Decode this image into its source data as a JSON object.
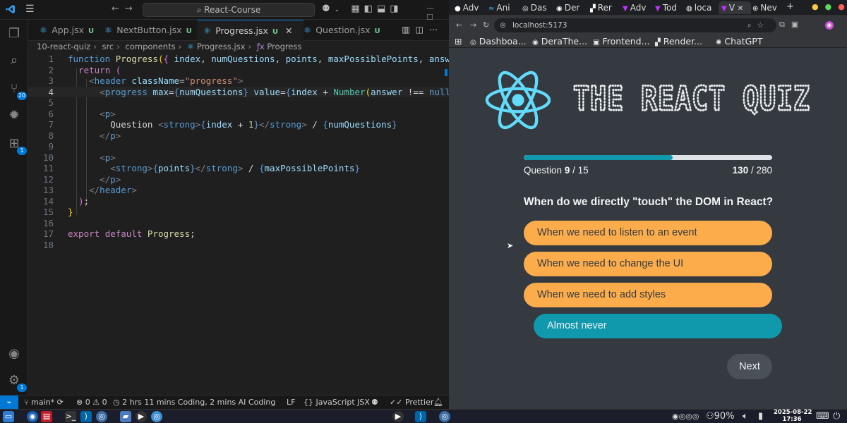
{
  "vscode": {
    "search_text": "React-Course",
    "tabs": [
      {
        "name": "App.jsx",
        "status": "U"
      },
      {
        "name": "NextButton.jsx",
        "status": "U"
      },
      {
        "name": "Progress.jsx",
        "status": "U",
        "active": true
      },
      {
        "name": "Question.jsx",
        "status": "U"
      }
    ],
    "breadcrumb": [
      "10-react-quiz",
      "src",
      "components",
      "Progress.jsx",
      "Progress"
    ],
    "activity_badges": {
      "source_control": "20",
      "extensions": "1",
      "settings": "1"
    },
    "line_numbers": [
      "1",
      "2",
      "3",
      "4",
      "5",
      "6",
      "7",
      "8",
      "9",
      "10",
      "11",
      "12",
      "13",
      "14",
      "15",
      "16",
      "17",
      "18"
    ],
    "current_line": 4,
    "status": {
      "branch": "main*",
      "errors": "0",
      "warnings": "0",
      "ports": "0",
      "coding_time": "2 hrs 11 mins Coding, 2 mins AI Coding",
      "eol": "LF",
      "language": "JavaScript JSX",
      "formatter": "Prettier"
    }
  },
  "browser": {
    "tabs": [
      "Adv",
      "Ani",
      "Das",
      "Der",
      "Rer",
      "Adv",
      "Tod",
      "loca",
      "V",
      "Nev"
    ],
    "url": "localhost:5173",
    "bookmarks": [
      "Dashboa...",
      "DeraThe...",
      "Frontend...",
      "Render...",
      "ChatGPT"
    ]
  },
  "quiz": {
    "title": "THE REACT QUIZ",
    "progress": {
      "index": 9,
      "numQuestions": 15,
      "points": 130,
      "maxPossiblePoints": 280,
      "question_label": "Question",
      "fill_fraction": 0.6
    },
    "question": "When do we directly \"touch\" the DOM in React?",
    "options": [
      {
        "text": "When we need to listen to an event",
        "selected": false
      },
      {
        "text": "When we need to change the UI",
        "selected": false
      },
      {
        "text": "When we need to add styles",
        "selected": false
      },
      {
        "text": "Almost never",
        "selected": true
      }
    ],
    "next_label": "Next",
    "colors": {
      "accent": "#1098ad",
      "option": "#fcac4b",
      "background": "#343a40",
      "text": "#f1f3f5"
    }
  },
  "taskbar": {
    "battery": "90%",
    "date": "2025-08-22",
    "time": "17:36"
  }
}
